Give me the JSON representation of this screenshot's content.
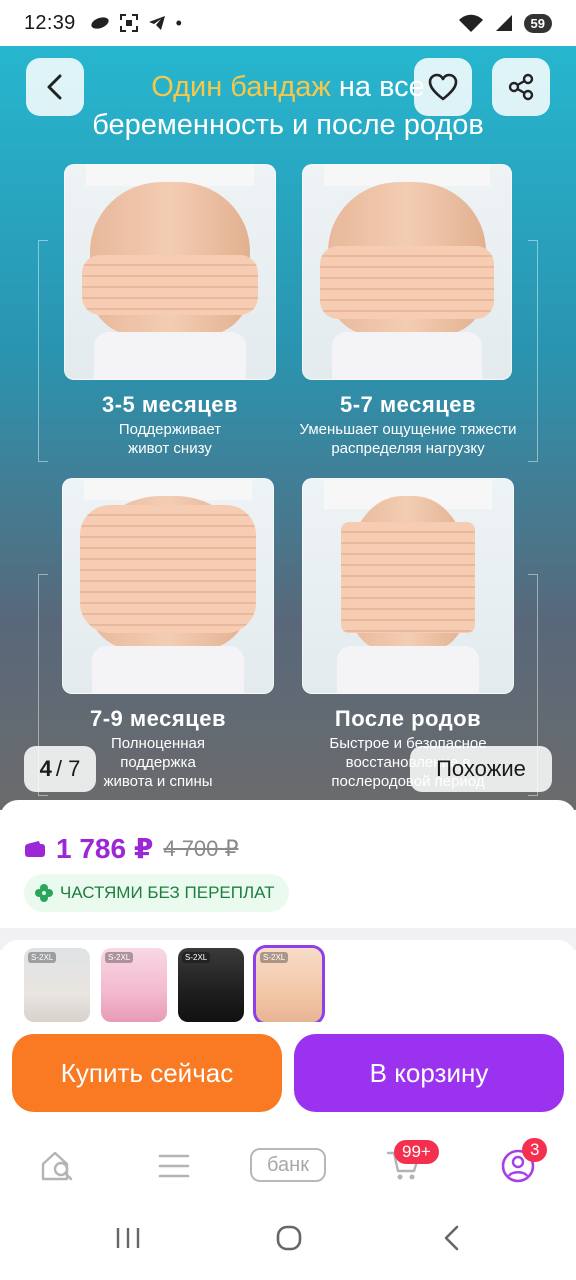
{
  "status_bar": {
    "time": "12:39",
    "battery": "59",
    "signal_label": "5"
  },
  "banner": {
    "title_accent": "Один бандаж",
    "title_rest_1": " на все",
    "title_line_2": "беременность и после родов",
    "panels": [
      {
        "title": "3-5 месяцев",
        "subtitle_1": "Поддерживает",
        "subtitle_2": "живот снизу"
      },
      {
        "title": "5-7 месяцев",
        "subtitle_1": "Уменьшает ощущение тяжести",
        "subtitle_2": "распределяя нагрузку"
      },
      {
        "title": "7-9 месяцев",
        "subtitle_1": "Полноценная",
        "subtitle_2": "поддержка",
        "subtitle_3": "живота и спины"
      },
      {
        "title": "После родов",
        "subtitle_1": "Быстрое и безопасное",
        "subtitle_2": "восстановление в",
        "subtitle_3": "послеродовой период"
      }
    ],
    "counter_current": "4",
    "counter_total": "/ 7",
    "similar_label": "Похожие"
  },
  "price": {
    "current": "1 786 ₽",
    "old": "4 700 ₽",
    "installment_label": "ЧАСТЯМИ БЕЗ ПЕРЕПЛАТ"
  },
  "thumbnails": [
    {
      "tag": "S-2XL",
      "color": "#e9e5e1"
    },
    {
      "tag": "S-2XL",
      "color": "#f3b9cf"
    },
    {
      "tag": "S-2XL",
      "color": "#1e1e1e"
    },
    {
      "tag": "S-2XL",
      "color": "#f2c7a8"
    }
  ],
  "actions": {
    "buy_now": "Купить сейчас",
    "add_to_cart": "В корзину"
  },
  "bottom_nav": {
    "bank_label": "банк",
    "cart_badge": "99+",
    "profile_badge": "3"
  },
  "colors": {
    "accent_purple": "#9b32f0",
    "accent_orange": "#f97a22",
    "price_color": "#9b27d6"
  }
}
